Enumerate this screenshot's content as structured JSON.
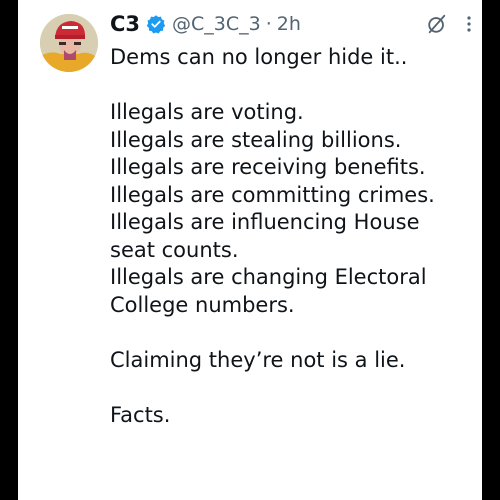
{
  "post": {
    "author_name": "C3",
    "handle": "@C_3C_3",
    "separator": "·",
    "time": "2h",
    "lines": [
      "Dems can no longer hide it..",
      "",
      "Illegals are voting.",
      "Illegals are stealing billions.",
      "Illegals are receiving benefits.",
      "Illegals are committing crimes.",
      "Illegals are influencing House",
      "seat counts.",
      "Illegals are changing Electoral",
      "College numbers.",
      "",
      "Claiming they’re not is a lie.",
      "",
      "Facts."
    ]
  },
  "icons": {
    "verified": "verified-badge-icon",
    "grok": "grok-icon",
    "more": "more-options-icon"
  },
  "colors": {
    "text": "#0f1419",
    "secondary": "#536471",
    "verified_blue": "#1d9bf0",
    "background": "#ffffff",
    "frame": "#000000"
  }
}
